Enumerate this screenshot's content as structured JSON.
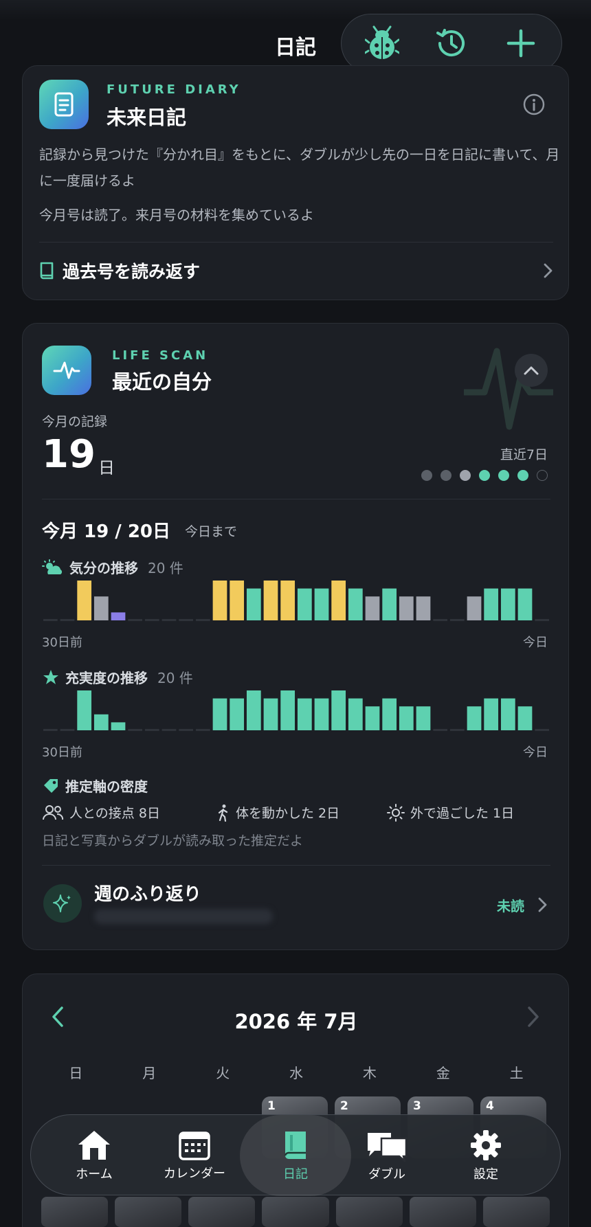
{
  "header": {
    "title": "日記",
    "actions": [
      "bug-icon",
      "history-icon",
      "plus-icon"
    ]
  },
  "future_diary": {
    "kicker": "FUTURE DIARY",
    "title": "未来日記",
    "description": "記録から見つけた『分かれ目』をもとに、ダブルが少し先の一日を日記に書いて、月に一度届けるよ",
    "status": "今月号は読了。来月号の材料を集めているよ",
    "link_label": "過去号を読み返す"
  },
  "life_scan": {
    "kicker": "LIFE SCAN",
    "title": "最近の自分",
    "records_label": "今月の記録",
    "records_value": "19",
    "records_unit": "日",
    "recent_label": "直近7日",
    "recent_dots": [
      "gray",
      "gray",
      "light",
      "teal",
      "teal",
      "teal",
      "empty"
    ],
    "progress_title": "今月 19 / 20日",
    "progress_note": "今日まで",
    "mood": {
      "label": "気分の推移",
      "count": "20 件",
      "axis_left": "30日前",
      "axis_right": "今日",
      "bars": [
        {
          "v": 0,
          "c": "none"
        },
        {
          "v": 0,
          "c": "none"
        },
        {
          "v": 1.0,
          "c": "yellow"
        },
        {
          "v": 0.6,
          "c": "gray"
        },
        {
          "v": 0.2,
          "c": "purple"
        },
        {
          "v": 0,
          "c": "none"
        },
        {
          "v": 0,
          "c": "none"
        },
        {
          "v": 0,
          "c": "none"
        },
        {
          "v": 0,
          "c": "none"
        },
        {
          "v": 0,
          "c": "none"
        },
        {
          "v": 1.0,
          "c": "yellow"
        },
        {
          "v": 1.0,
          "c": "yellow"
        },
        {
          "v": 0.8,
          "c": "teal"
        },
        {
          "v": 1.0,
          "c": "yellow"
        },
        {
          "v": 1.0,
          "c": "yellow"
        },
        {
          "v": 0.8,
          "c": "teal"
        },
        {
          "v": 0.8,
          "c": "teal"
        },
        {
          "v": 1.0,
          "c": "yellow"
        },
        {
          "v": 0.8,
          "c": "teal"
        },
        {
          "v": 0.6,
          "c": "gray"
        },
        {
          "v": 0.8,
          "c": "teal"
        },
        {
          "v": 0.6,
          "c": "gray"
        },
        {
          "v": 0.6,
          "c": "gray"
        },
        {
          "v": 0,
          "c": "none"
        },
        {
          "v": 0,
          "c": "none"
        },
        {
          "v": 0.6,
          "c": "gray"
        },
        {
          "v": 0.8,
          "c": "teal"
        },
        {
          "v": 0.8,
          "c": "teal"
        },
        {
          "v": 0.8,
          "c": "teal"
        },
        {
          "v": 0,
          "c": "none"
        }
      ]
    },
    "fulfillment": {
      "label": "充実度の推移",
      "count": "20 件",
      "axis_left": "30日前",
      "axis_right": "今日",
      "bars": [
        {
          "v": 0,
          "c": "none"
        },
        {
          "v": 0,
          "c": "none"
        },
        {
          "v": 1.0,
          "c": "teal"
        },
        {
          "v": 0.4,
          "c": "teal"
        },
        {
          "v": 0.2,
          "c": "teal"
        },
        {
          "v": 0,
          "c": "none"
        },
        {
          "v": 0,
          "c": "none"
        },
        {
          "v": 0,
          "c": "none"
        },
        {
          "v": 0,
          "c": "none"
        },
        {
          "v": 0,
          "c": "none"
        },
        {
          "v": 0.8,
          "c": "teal"
        },
        {
          "v": 0.8,
          "c": "teal"
        },
        {
          "v": 1.0,
          "c": "teal"
        },
        {
          "v": 0.8,
          "c": "teal"
        },
        {
          "v": 1.0,
          "c": "teal"
        },
        {
          "v": 0.8,
          "c": "teal"
        },
        {
          "v": 0.8,
          "c": "teal"
        },
        {
          "v": 1.0,
          "c": "teal"
        },
        {
          "v": 0.8,
          "c": "teal"
        },
        {
          "v": 0.6,
          "c": "teal"
        },
        {
          "v": 0.8,
          "c": "teal"
        },
        {
          "v": 0.6,
          "c": "teal"
        },
        {
          "v": 0.6,
          "c": "teal"
        },
        {
          "v": 0,
          "c": "none"
        },
        {
          "v": 0,
          "c": "none"
        },
        {
          "v": 0.6,
          "c": "teal"
        },
        {
          "v": 0.8,
          "c": "teal"
        },
        {
          "v": 0.8,
          "c": "teal"
        },
        {
          "v": 0.6,
          "c": "teal"
        },
        {
          "v": 0,
          "c": "none"
        }
      ]
    },
    "density_title": "推定軸の密度",
    "facets": [
      {
        "icon": "people-icon",
        "label": "人との接点 8日"
      },
      {
        "icon": "walk-icon",
        "label": "体を動かした 2日"
      },
      {
        "icon": "sun-icon",
        "label": "外で過ごした 1日"
      }
    ],
    "density_note": "日記と写真からダブルが読み取った推定だよ",
    "weekly_review": {
      "title": "週のふり返り",
      "status": "未読"
    }
  },
  "calendar": {
    "month": "2026 年 7月",
    "weekdays": [
      "日",
      "月",
      "火",
      "水",
      "木",
      "金",
      "土"
    ],
    "days": [
      "1",
      "2",
      "3",
      "4"
    ]
  },
  "tabbar": {
    "tabs": [
      {
        "label": "ホーム",
        "icon": "home-icon"
      },
      {
        "label": "カレンダー",
        "icon": "calendar-icon"
      },
      {
        "label": "日記",
        "icon": "diary-icon"
      },
      {
        "label": "ダブル",
        "icon": "chat-icon"
      },
      {
        "label": "設定",
        "icon": "gear-icon"
      }
    ],
    "active": "日記"
  },
  "colors": {
    "accent": "#5ed1b0",
    "yellow": "#f2cb5c",
    "gray": "#9fa3ac",
    "purple": "#8b7ee8",
    "teal": "#5ed1b0",
    "background": "#121418",
    "card": "#1c1f25"
  }
}
